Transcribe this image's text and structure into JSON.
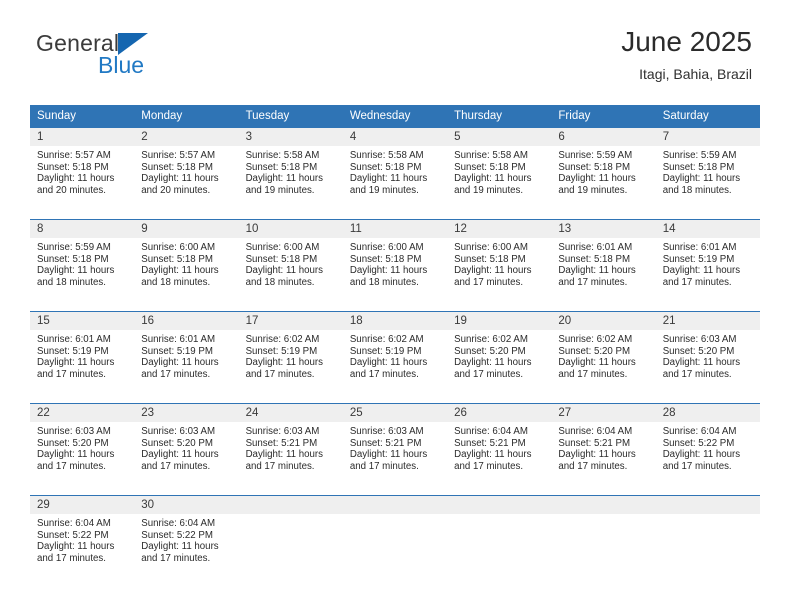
{
  "brand": {
    "name_part1": "General",
    "name_part2": "Blue",
    "triangle_icon": "triangle-icon",
    "primary_color": "#2f74b5",
    "accent_color": "#1566b0"
  },
  "header": {
    "title": "June 2025",
    "subtitle": "Itagi, Bahia, Brazil"
  },
  "calendar": {
    "weekday_headers": [
      "Sunday",
      "Monday",
      "Tuesday",
      "Wednesday",
      "Thursday",
      "Friday",
      "Saturday"
    ],
    "header_bg": "#2f74b5",
    "daynum_bg": "#efefef",
    "weeks": [
      [
        {
          "day": "1",
          "sunrise": "Sunrise: 5:57 AM",
          "sunset": "Sunset: 5:18 PM",
          "daylight": "Daylight: 11 hours and 20 minutes."
        },
        {
          "day": "2",
          "sunrise": "Sunrise: 5:57 AM",
          "sunset": "Sunset: 5:18 PM",
          "daylight": "Daylight: 11 hours and 20 minutes."
        },
        {
          "day": "3",
          "sunrise": "Sunrise: 5:58 AM",
          "sunset": "Sunset: 5:18 PM",
          "daylight": "Daylight: 11 hours and 19 minutes."
        },
        {
          "day": "4",
          "sunrise": "Sunrise: 5:58 AM",
          "sunset": "Sunset: 5:18 PM",
          "daylight": "Daylight: 11 hours and 19 minutes."
        },
        {
          "day": "5",
          "sunrise": "Sunrise: 5:58 AM",
          "sunset": "Sunset: 5:18 PM",
          "daylight": "Daylight: 11 hours and 19 minutes."
        },
        {
          "day": "6",
          "sunrise": "Sunrise: 5:59 AM",
          "sunset": "Sunset: 5:18 PM",
          "daylight": "Daylight: 11 hours and 19 minutes."
        },
        {
          "day": "7",
          "sunrise": "Sunrise: 5:59 AM",
          "sunset": "Sunset: 5:18 PM",
          "daylight": "Daylight: 11 hours and 18 minutes."
        }
      ],
      [
        {
          "day": "8",
          "sunrise": "Sunrise: 5:59 AM",
          "sunset": "Sunset: 5:18 PM",
          "daylight": "Daylight: 11 hours and 18 minutes."
        },
        {
          "day": "9",
          "sunrise": "Sunrise: 6:00 AM",
          "sunset": "Sunset: 5:18 PM",
          "daylight": "Daylight: 11 hours and 18 minutes."
        },
        {
          "day": "10",
          "sunrise": "Sunrise: 6:00 AM",
          "sunset": "Sunset: 5:18 PM",
          "daylight": "Daylight: 11 hours and 18 minutes."
        },
        {
          "day": "11",
          "sunrise": "Sunrise: 6:00 AM",
          "sunset": "Sunset: 5:18 PM",
          "daylight": "Daylight: 11 hours and 18 minutes."
        },
        {
          "day": "12",
          "sunrise": "Sunrise: 6:00 AM",
          "sunset": "Sunset: 5:18 PM",
          "daylight": "Daylight: 11 hours and 17 minutes."
        },
        {
          "day": "13",
          "sunrise": "Sunrise: 6:01 AM",
          "sunset": "Sunset: 5:18 PM",
          "daylight": "Daylight: 11 hours and 17 minutes."
        },
        {
          "day": "14",
          "sunrise": "Sunrise: 6:01 AM",
          "sunset": "Sunset: 5:19 PM",
          "daylight": "Daylight: 11 hours and 17 minutes."
        }
      ],
      [
        {
          "day": "15",
          "sunrise": "Sunrise: 6:01 AM",
          "sunset": "Sunset: 5:19 PM",
          "daylight": "Daylight: 11 hours and 17 minutes."
        },
        {
          "day": "16",
          "sunrise": "Sunrise: 6:01 AM",
          "sunset": "Sunset: 5:19 PM",
          "daylight": "Daylight: 11 hours and 17 minutes."
        },
        {
          "day": "17",
          "sunrise": "Sunrise: 6:02 AM",
          "sunset": "Sunset: 5:19 PM",
          "daylight": "Daylight: 11 hours and 17 minutes."
        },
        {
          "day": "18",
          "sunrise": "Sunrise: 6:02 AM",
          "sunset": "Sunset: 5:19 PM",
          "daylight": "Daylight: 11 hours and 17 minutes."
        },
        {
          "day": "19",
          "sunrise": "Sunrise: 6:02 AM",
          "sunset": "Sunset: 5:20 PM",
          "daylight": "Daylight: 11 hours and 17 minutes."
        },
        {
          "day": "20",
          "sunrise": "Sunrise: 6:02 AM",
          "sunset": "Sunset: 5:20 PM",
          "daylight": "Daylight: 11 hours and 17 minutes."
        },
        {
          "day": "21",
          "sunrise": "Sunrise: 6:03 AM",
          "sunset": "Sunset: 5:20 PM",
          "daylight": "Daylight: 11 hours and 17 minutes."
        }
      ],
      [
        {
          "day": "22",
          "sunrise": "Sunrise: 6:03 AM",
          "sunset": "Sunset: 5:20 PM",
          "daylight": "Daylight: 11 hours and 17 minutes."
        },
        {
          "day": "23",
          "sunrise": "Sunrise: 6:03 AM",
          "sunset": "Sunset: 5:20 PM",
          "daylight": "Daylight: 11 hours and 17 minutes."
        },
        {
          "day": "24",
          "sunrise": "Sunrise: 6:03 AM",
          "sunset": "Sunset: 5:21 PM",
          "daylight": "Daylight: 11 hours and 17 minutes."
        },
        {
          "day": "25",
          "sunrise": "Sunrise: 6:03 AM",
          "sunset": "Sunset: 5:21 PM",
          "daylight": "Daylight: 11 hours and 17 minutes."
        },
        {
          "day": "26",
          "sunrise": "Sunrise: 6:04 AM",
          "sunset": "Sunset: 5:21 PM",
          "daylight": "Daylight: 11 hours and 17 minutes."
        },
        {
          "day": "27",
          "sunrise": "Sunrise: 6:04 AM",
          "sunset": "Sunset: 5:21 PM",
          "daylight": "Daylight: 11 hours and 17 minutes."
        },
        {
          "day": "28",
          "sunrise": "Sunrise: 6:04 AM",
          "sunset": "Sunset: 5:22 PM",
          "daylight": "Daylight: 11 hours and 17 minutes."
        }
      ],
      [
        {
          "day": "29",
          "sunrise": "Sunrise: 6:04 AM",
          "sunset": "Sunset: 5:22 PM",
          "daylight": "Daylight: 11 hours and 17 minutes."
        },
        {
          "day": "30",
          "sunrise": "Sunrise: 6:04 AM",
          "sunset": "Sunset: 5:22 PM",
          "daylight": "Daylight: 11 hours and 17 minutes."
        },
        {
          "day": "",
          "sunrise": "",
          "sunset": "",
          "daylight": ""
        },
        {
          "day": "",
          "sunrise": "",
          "sunset": "",
          "daylight": ""
        },
        {
          "day": "",
          "sunrise": "",
          "sunset": "",
          "daylight": ""
        },
        {
          "day": "",
          "sunrise": "",
          "sunset": "",
          "daylight": ""
        },
        {
          "day": "",
          "sunrise": "",
          "sunset": "",
          "daylight": ""
        }
      ]
    ]
  }
}
